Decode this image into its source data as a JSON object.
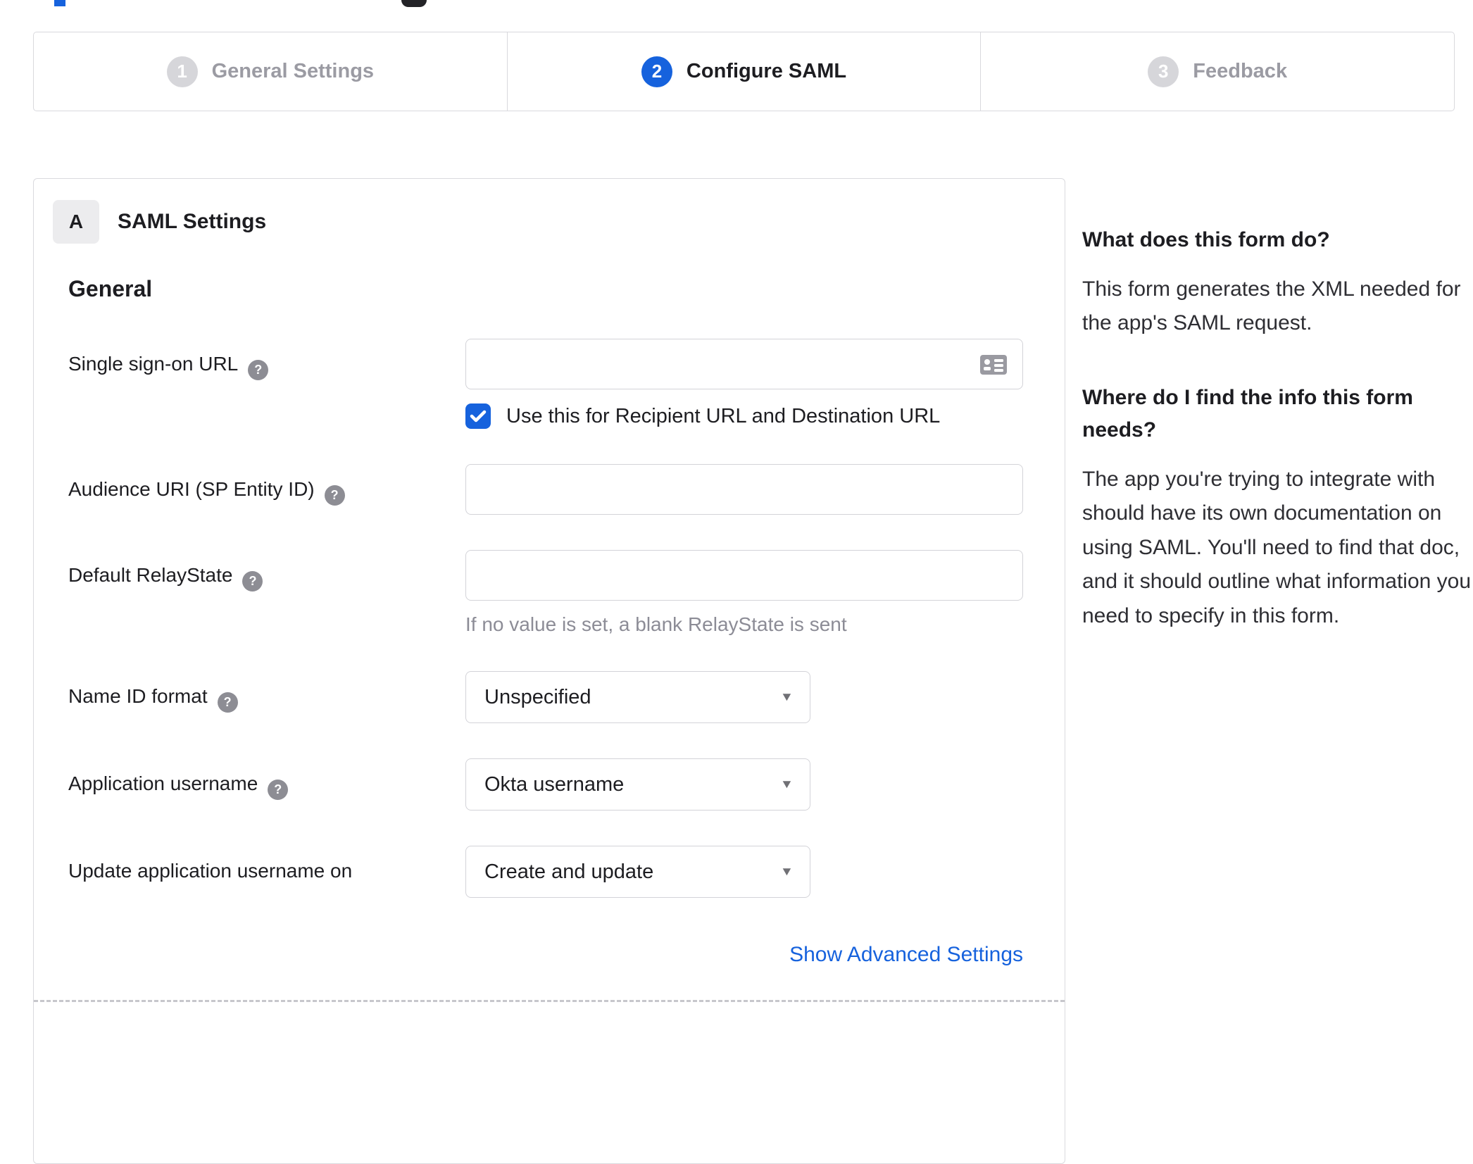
{
  "stepper": {
    "steps": [
      {
        "number": "1",
        "label": "General Settings",
        "state": "inactive"
      },
      {
        "number": "2",
        "label": "Configure SAML",
        "state": "active"
      },
      {
        "number": "3",
        "label": "Feedback",
        "state": "inactive"
      }
    ]
  },
  "panel": {
    "badge": "A",
    "title": "SAML Settings",
    "section_heading": "General",
    "advanced_link": "Show Advanced Settings",
    "fields": {
      "sso_url": {
        "label": "Single sign-on URL",
        "value": "",
        "trailing_icon": "contact-card-icon",
        "checkbox_label": "Use this for Recipient URL and Destination URL",
        "checkbox_checked": true
      },
      "audience_uri": {
        "label": "Audience URI (SP Entity ID)",
        "value": ""
      },
      "relay_state": {
        "label": "Default RelayState",
        "value": "",
        "helper": "If no value is set, a blank RelayState is sent"
      },
      "name_id_format": {
        "label": "Name ID format",
        "value": "Unspecified"
      },
      "app_username": {
        "label": "Application username",
        "value": "Okta username"
      },
      "update_username": {
        "label": "Update application username on",
        "value": "Create and update"
      }
    }
  },
  "sidebar": {
    "sections": [
      {
        "heading": "What does this form do?",
        "body": "This form generates the XML needed for the app's SAML request."
      },
      {
        "heading": "Where do I find the info this form needs?",
        "body": "The app you're trying to integrate with should have its own documentation on using SAML. You'll need to find that doc, and it should outline what information you need to specify in this form."
      }
    ]
  },
  "colors": {
    "accent": "#1662dd",
    "text": "#1d1d21",
    "inactive_step": "#9b9ba3",
    "border": "#d9d9dd",
    "muted": "#8c8c96"
  }
}
